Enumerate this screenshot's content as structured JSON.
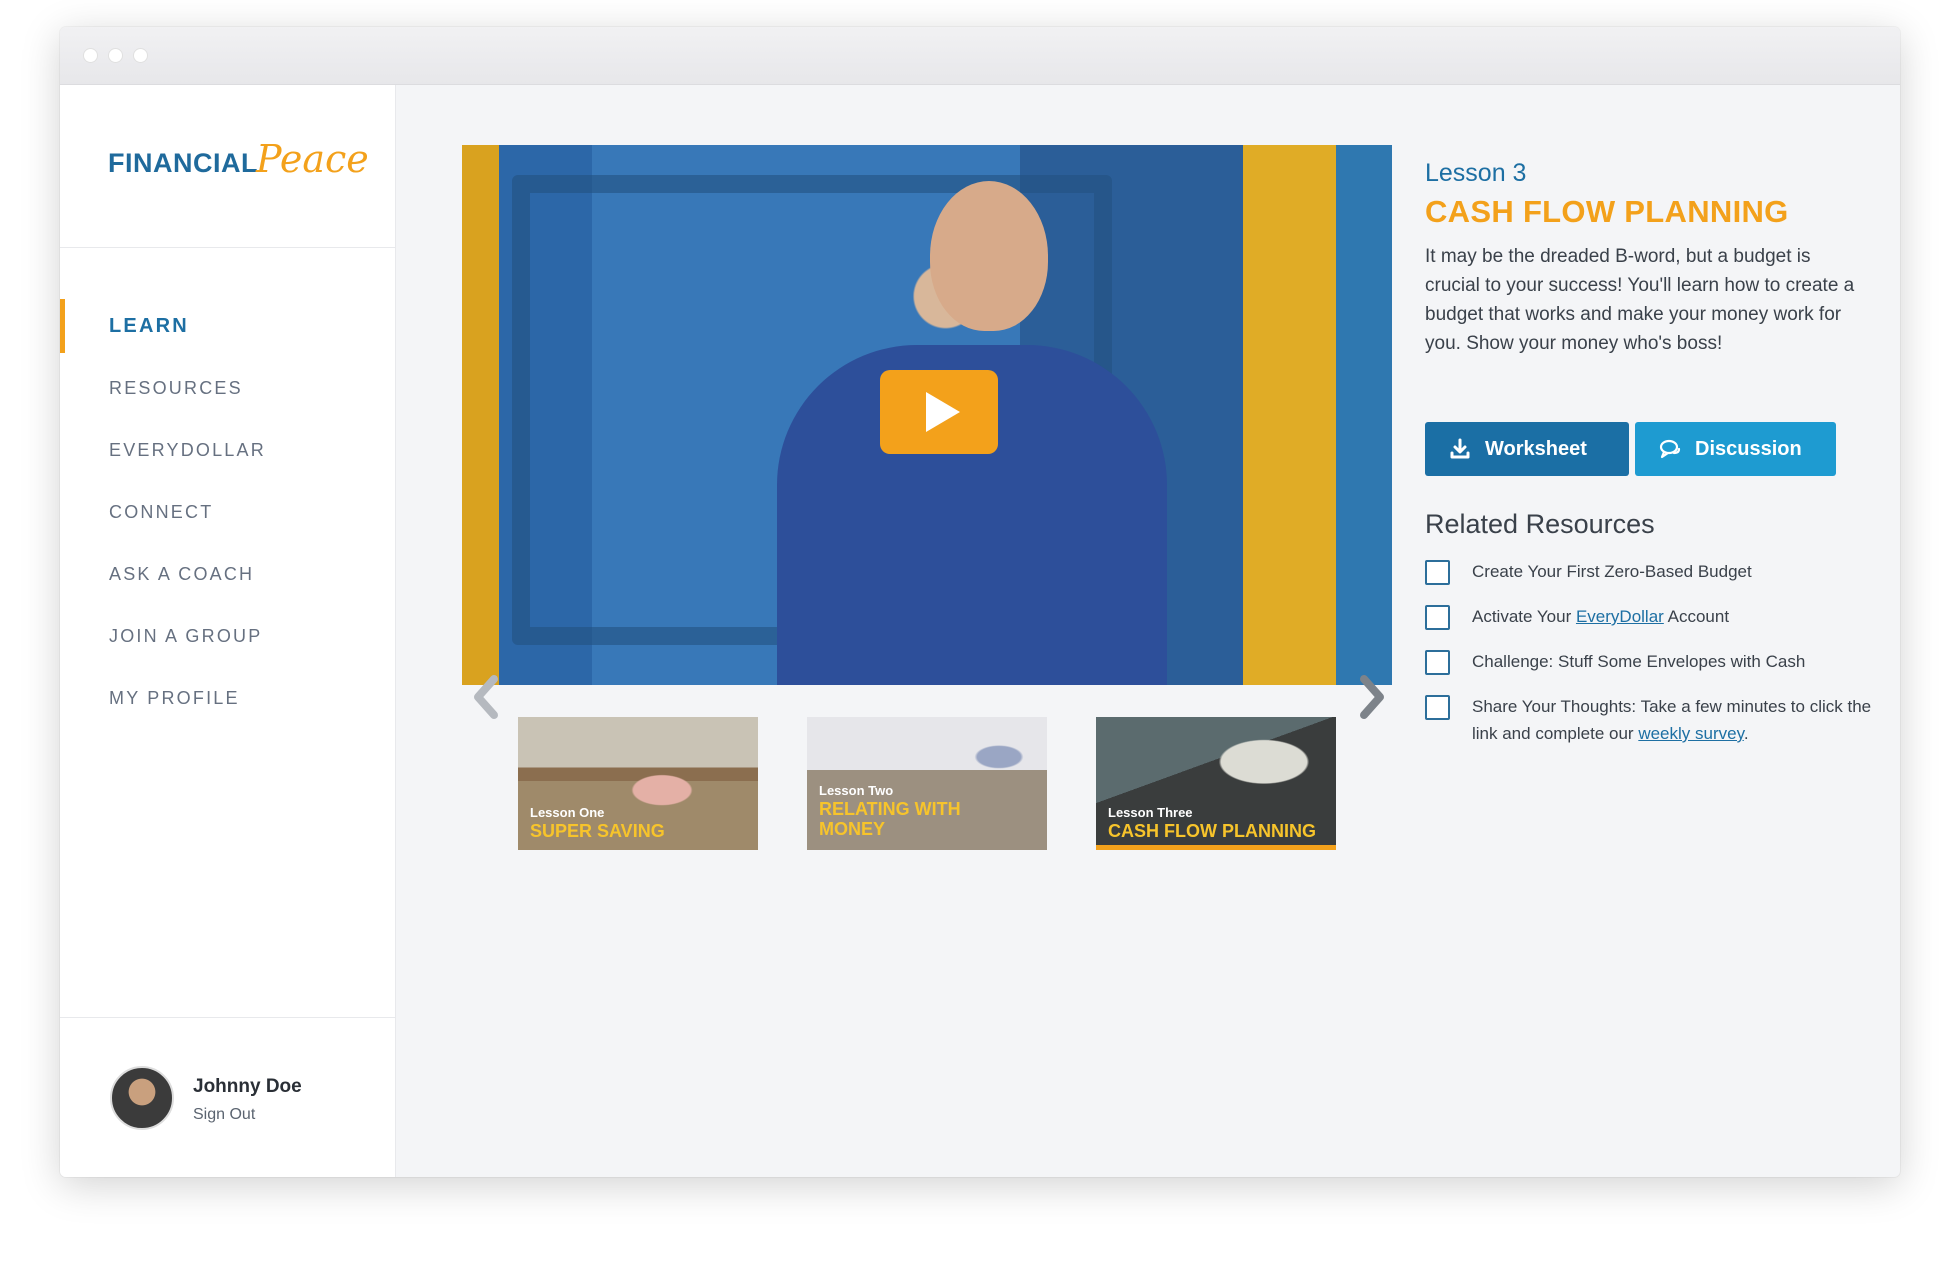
{
  "brand": {
    "logo_part1": "FINANCIAL",
    "logo_part2": "Peace"
  },
  "nav": [
    {
      "label": "LEARN",
      "active": true
    },
    {
      "label": "RESOURCES"
    },
    {
      "label": "EVERYDOLLAR"
    },
    {
      "label": "CONNECT"
    },
    {
      "label": "ASK A COACH"
    },
    {
      "label": "JOIN A GROUP"
    },
    {
      "label": "MY PROFILE"
    }
  ],
  "user": {
    "name": "Johnny Doe",
    "sign_out": "Sign Out"
  },
  "lesson": {
    "number": "Lesson 3",
    "title": "CASH FLOW PLANNING",
    "description": "It may be the dreaded B-word, but a budget is crucial to your success! You'll learn how to create a budget that works and make your money work for you. Show your money who's boss!"
  },
  "buttons": {
    "worksheet": "Worksheet",
    "discussion": "Discussion"
  },
  "related": {
    "title": "Related Resources",
    "items": [
      {
        "text": "Create Your First Zero-Based Budget"
      },
      {
        "before": "Activate Your ",
        "link": "EveryDollar",
        "after": " Account"
      },
      {
        "text": "Challenge: Stuff Some Envelopes with Cash"
      },
      {
        "before": "Share Your Thoughts: Take a few minutes to click the link and complete our ",
        "link": "weekly survey",
        "after": "."
      }
    ]
  },
  "thumbnails": [
    {
      "lesson": "Lesson One",
      "title_line1": "SUPER SAVING",
      "title_line2": ""
    },
    {
      "lesson": "Lesson Two",
      "title_line1": "RELATING WITH",
      "title_line2": "MONEY"
    },
    {
      "lesson": "Lesson Three",
      "title_line1": "CASH FLOW PLANNING",
      "title_line2": "",
      "active": true
    }
  ],
  "colors": {
    "brand_blue": "#1d6fa3",
    "brand_orange": "#f3a11b",
    "discussion_blue": "#1e9bd1"
  },
  "icons": {
    "worksheet": "download-icon",
    "discussion": "chat-bubbles-icon",
    "play": "play-icon",
    "prev": "chevron-left-icon",
    "next": "chevron-right-icon"
  }
}
